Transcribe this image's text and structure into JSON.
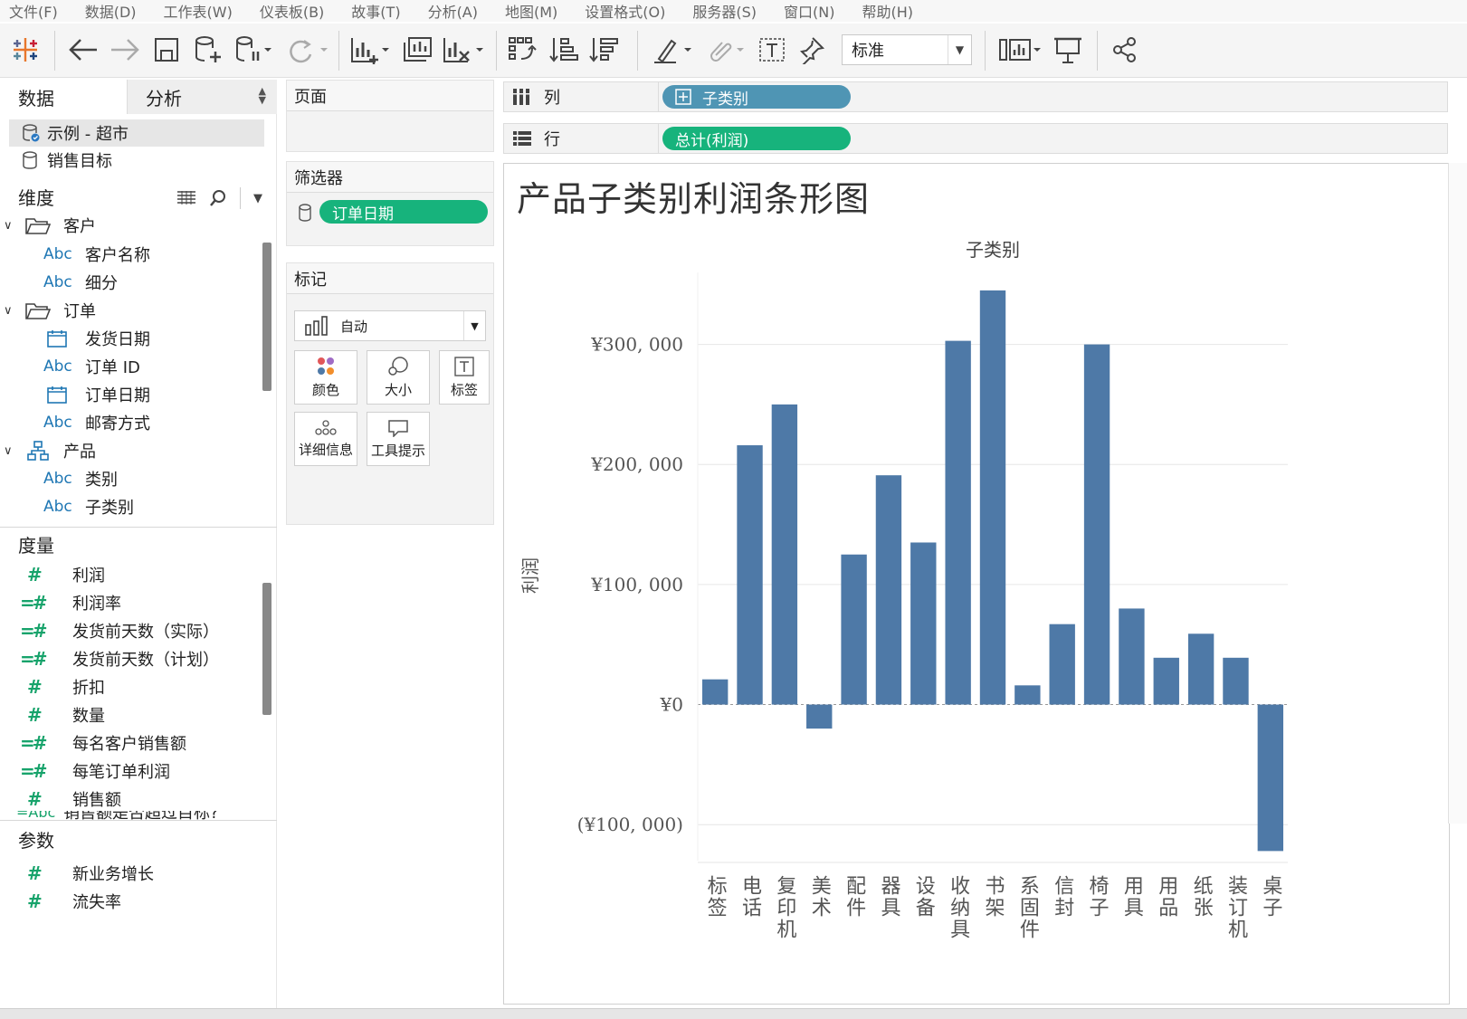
{
  "menu": [
    "文件(F)",
    "数据(D)",
    "工作表(W)",
    "仪表板(B)",
    "故事(T)",
    "分析(A)",
    "地图(M)",
    "设置格式(O)",
    "服务器(S)",
    "窗口(N)",
    "帮助(H)"
  ],
  "toolbar": {
    "fit_value": "标准"
  },
  "left": {
    "tab_data": "数据",
    "tab_analysis": "分析",
    "datasources": [
      "示例 - 超市",
      "销售目标"
    ],
    "dimensions_title": "维度",
    "groups": [
      {
        "name": "客户",
        "fields": [
          {
            "type": "Abc",
            "name": "客户名称"
          },
          {
            "type": "Abc",
            "name": "细分"
          }
        ]
      },
      {
        "name": "订单",
        "fields": [
          {
            "type": "date",
            "name": "发货日期"
          },
          {
            "type": "Abc",
            "name": "订单 ID"
          },
          {
            "type": "date",
            "name": "订单日期"
          },
          {
            "type": "Abc",
            "name": "邮寄方式"
          }
        ]
      },
      {
        "name": "产品",
        "fields": [
          {
            "type": "Abc",
            "name": "类别"
          },
          {
            "type": "Abc",
            "name": "子类别"
          }
        ]
      }
    ],
    "abc_label": "Abc",
    "measures_title": "度量",
    "measures": [
      "利润",
      "利润率",
      "发货前天数（实际）",
      "发货前天数（计划）",
      "折扣",
      "数量",
      "每名客户销售额",
      "每笔订单利润",
      "销售额",
      "销售额是否超过目标?"
    ],
    "params_title": "参数",
    "params": [
      "新业务增长",
      "流失率"
    ]
  },
  "pages_title": "页面",
  "filters_title": "筛选器",
  "filter_pill": "订单日期",
  "marks": {
    "title": "标记",
    "type": "自动",
    "buttons": [
      "颜色",
      "大小",
      "标签",
      "详细信息",
      "工具提示"
    ]
  },
  "shelves": {
    "columns_label": "列",
    "columns_pill": "子类别",
    "rows_label": "行",
    "rows_pill": "总计(利润)"
  },
  "colors": {
    "bar": "#4e79a7",
    "green_pill": "#17b37c",
    "blue_pill": "#4f95b4"
  },
  "chart_data": {
    "type": "bar",
    "title": "产品子类别利润条形图",
    "header": "子类别",
    "ylabel": "利润",
    "categories": [
      "标签",
      "电话",
      "复印机",
      "美术",
      "配件",
      "器具",
      "设备",
      "收纳具",
      "书架",
      "系固件",
      "信封",
      "椅子",
      "用具",
      "用品",
      "纸张",
      "装订机",
      "桌子"
    ],
    "values": [
      21000,
      216000,
      250000,
      -20000,
      125000,
      191000,
      135000,
      303000,
      345000,
      16000,
      67000,
      300000,
      80000,
      39000,
      59000,
      39000,
      -122000
    ],
    "ylim": [
      -130000,
      360000
    ],
    "yticks": [
      -100000,
      0,
      100000,
      200000,
      300000
    ],
    "ytick_labels": [
      "(¥100, 000)",
      "¥0",
      "¥100, 000",
      "¥200, 000",
      "¥300, 000"
    ],
    "grid": true
  }
}
